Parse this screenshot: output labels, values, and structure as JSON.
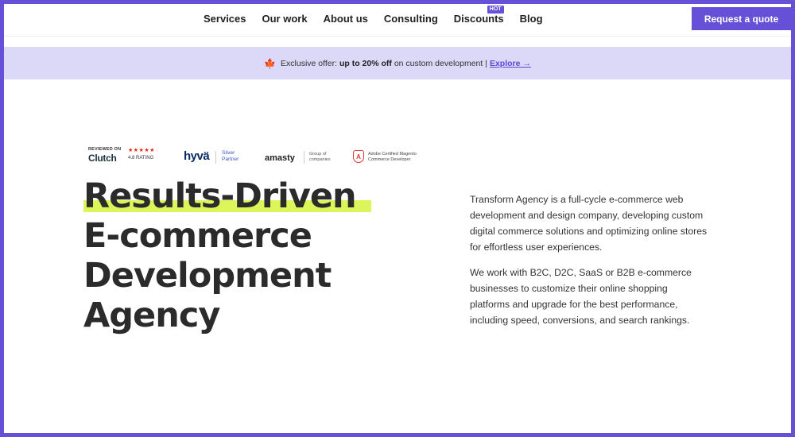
{
  "nav": {
    "items": [
      {
        "label": "Services"
      },
      {
        "label": "Our work"
      },
      {
        "label": "About us"
      },
      {
        "label": "Consulting"
      },
      {
        "label": "Discounts",
        "badge": "HOT"
      },
      {
        "label": "Blog"
      }
    ],
    "cta_label": "Request a quote"
  },
  "banner": {
    "prefix": "Exclusive offer: ",
    "highlight": "up to 20% off",
    "suffix": " on custom development | ",
    "link": "Explore →"
  },
  "badges": {
    "clutch": {
      "small": "REVIEWED ON",
      "name": "Clutch",
      "stars": "★★★★★",
      "rating": "4.8 RATING"
    },
    "hyva": {
      "name": "hyvä",
      "sub1": "Silver",
      "sub2": "Partner"
    },
    "amasty": {
      "name": "amasty",
      "sub1": "Group of",
      "sub2": "companies"
    },
    "adobe": {
      "sub1": "Adobe Certified Magento",
      "sub2": "Commerce Developer"
    }
  },
  "headline": {
    "line1": "Results-Driven",
    "line2": "E-commerce",
    "line3": "Development",
    "line4": "Agency"
  },
  "description": {
    "p1": "Transform Agency is a full-cycle e-commerce web development and design company, developing custom digital commerce solutions and optimizing online stores for effortless user experiences.",
    "p2": "We work with B2C, D2C, SaaS or B2B e-commerce businesses to customize their online shopping platforms and upgrade for the best performance, including speed, conversions, and search rankings."
  },
  "colors": {
    "accent": "#6650d8",
    "banner_bg": "#dcd8f8",
    "highlight": "#dcf55a",
    "headline": "#2b2b2b"
  }
}
